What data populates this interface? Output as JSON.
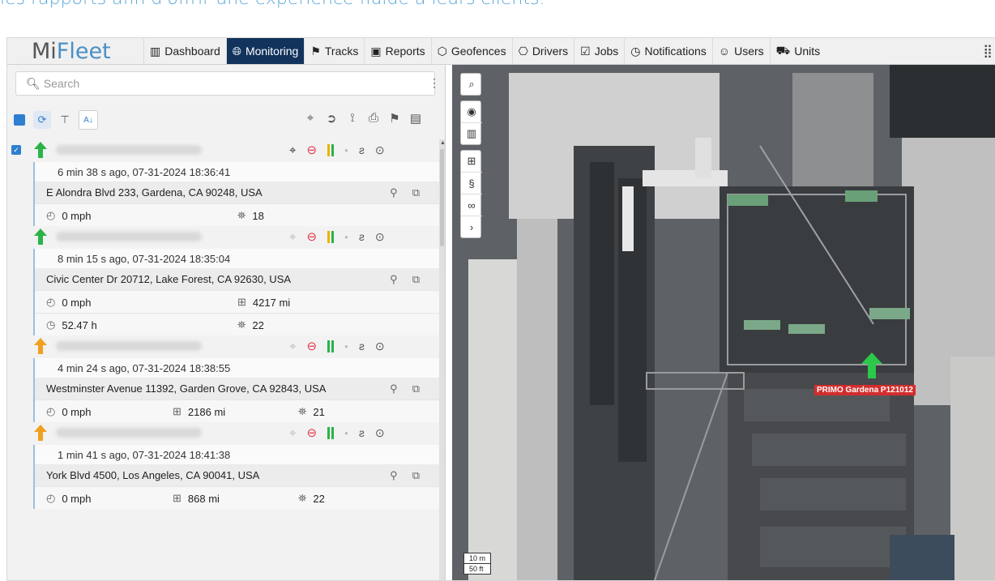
{
  "marketing_text": "les rapports afin d'offrir une expérience fluide à leurs clients.",
  "app": {
    "logo_mi": "Mi",
    "logo_fleet": "Fleet"
  },
  "nav": [
    {
      "label": "Dashboard",
      "icon": "bar-chart-icon"
    },
    {
      "label": "Monitoring",
      "icon": "globe-icon",
      "active": true
    },
    {
      "label": "Tracks",
      "icon": "flag-icon"
    },
    {
      "label": "Reports",
      "icon": "report-icon"
    },
    {
      "label": "Geofences",
      "icon": "geofence-icon"
    },
    {
      "label": "Drivers",
      "icon": "steering-wheel-icon"
    },
    {
      "label": "Jobs",
      "icon": "check-square-icon"
    },
    {
      "label": "Notifications",
      "icon": "clock-icon"
    },
    {
      "label": "Users",
      "icon": "user-icon"
    },
    {
      "label": "Units",
      "icon": "truck-icon"
    }
  ],
  "search": {
    "placeholder": "Search"
  },
  "units": [
    {
      "arrow_color": "#2bb34a",
      "checked": true,
      "loc_light": false,
      "bars": [
        "#e8b400",
        "#2bb34a"
      ],
      "time": "6 min 38 s ago, 07-31-2024 18:36:41",
      "address": "E Alondra Blvd 233, Gardena, CA 90248, USA",
      "speed": "0 mph",
      "odometer": "",
      "hours": "",
      "satellites": "18"
    },
    {
      "arrow_color": "#2bb34a",
      "checked": false,
      "loc_light": true,
      "bars": [
        "#e8b400",
        "#2bb34a"
      ],
      "time": "8 min 15 s ago, 07-31-2024 18:35:04",
      "address": "Civic Center Dr 20712, Lake Forest, CA 92630, USA",
      "speed": "0 mph",
      "odometer": "4217 mi",
      "hours": "52.47 h",
      "satellites": "22"
    },
    {
      "arrow_color": "#f0a020",
      "checked": false,
      "loc_light": true,
      "bars": [
        "#2bb34a",
        "#2bb34a"
      ],
      "time": "4 min 24 s ago, 07-31-2024 18:38:55",
      "address": "Westminster Avenue 11392, Garden Grove, CA 92843, USA",
      "speed": "0 mph",
      "odometer": "2186 mi",
      "hours": "",
      "satellites": "21"
    },
    {
      "arrow_color": "#f0a020",
      "checked": false,
      "loc_light": true,
      "bars": [
        "#2bb34a",
        "#2bb34a"
      ],
      "time": "1 min 41 s ago, 07-31-2024 18:41:38",
      "address": "York Blvd 4500, Los Angeles, CA 90041, USA",
      "speed": "0 mph",
      "odometer": "868 mi",
      "hours": "",
      "satellites": "22"
    }
  ],
  "map": {
    "vehicle_label": "PRIMO Gardena P121012",
    "scale_m": "10 m",
    "scale_ft": "50 ft"
  }
}
